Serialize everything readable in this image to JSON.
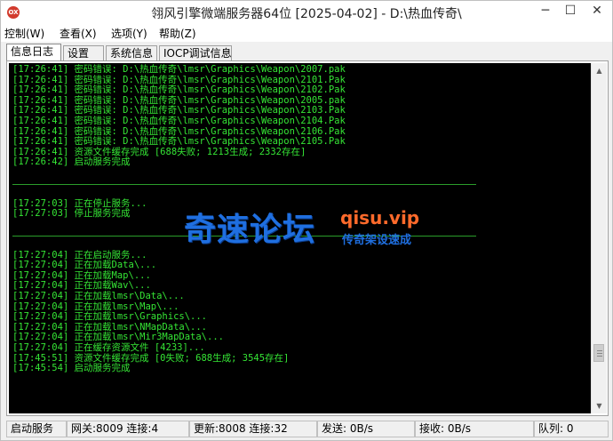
{
  "window": {
    "title": "翎风引擎微端服务器64位 [2025-04-02] - D:\\热血传奇\\",
    "icon_label": "OX",
    "minimize_glyph": "─",
    "maximize_glyph": "☐",
    "close_glyph": "✕"
  },
  "menu": [
    {
      "label": "控制(W)"
    },
    {
      "label": "查看(X)"
    },
    {
      "label": "选项(Y)"
    },
    {
      "label": "帮助(Z)"
    }
  ],
  "tabs": [
    {
      "label": "信息日志",
      "active": true
    },
    {
      "label": "设置",
      "active": false
    },
    {
      "label": "系统信息",
      "active": false
    },
    {
      "label": "IOCP调试信息",
      "active": false
    }
  ],
  "log_lines": [
    "[17:26:41] 密码错误: D:\\热血传奇\\lmsr\\Graphics\\Weapon\\2007.pak",
    "[17:26:41] 密码错误: D:\\热血传奇\\lmsr\\Graphics\\Weapon\\2101.Pak",
    "[17:26:41] 密码错误: D:\\热血传奇\\lmsr\\Graphics\\Weapon\\2102.Pak",
    "[17:26:41] 密码错误: D:\\热血传奇\\lmsr\\Graphics\\Weapon\\2005.pak",
    "[17:26:41] 密码错误: D:\\热血传奇\\lmsr\\Graphics\\Weapon\\2103.Pak",
    "[17:26:41] 密码错误: D:\\热血传奇\\lmsr\\Graphics\\Weapon\\2104.Pak",
    "[17:26:41] 密码错误: D:\\热血传奇\\lmsr\\Graphics\\Weapon\\2106.Pak",
    "[17:26:41] 密码错误: D:\\热血传奇\\lmsr\\Graphics\\Weapon\\2105.Pak",
    "[17:26:41] 资源文件缓存完成 [688失败; 1213生成; 2332存在]",
    "[17:26:42] 启动服务完成",
    "",
    "---",
    "",
    "[17:27:03] 正在停止服务...",
    "[17:27:03] 停止服务完成",
    "",
    "---",
    "",
    "[17:27:04] 正在启动服务...",
    "[17:27:04] 正在加载Data\\...",
    "[17:27:04] 正在加载Map\\...",
    "[17:27:04] 正在加载Wav\\...",
    "[17:27:04] 正在加载lmsr\\Data\\...",
    "[17:27:04] 正在加载lmsr\\Map\\...",
    "[17:27:04] 正在加载lmsr\\Graphics\\...",
    "[17:27:04] 正在加载lmsr\\NMapData\\...",
    "[17:27:04] 正在加载lmsr\\Mir3MapData\\...",
    "[17:27:04] 正在缓存资源文件 [4233]...",
    "[17:45:51] 资源文件缓存完成 [0失败; 688生成; 3545存在]",
    "[17:45:54] 启动服务完成"
  ],
  "watermark": {
    "brand_cn": "奇速论坛",
    "brand_en": "qisu.vip",
    "slogan": "传奇架设速成"
  },
  "status": [
    {
      "label": "启动服务"
    },
    {
      "label": "网关:8009  连接:4"
    },
    {
      "label": "更新:8008  连接:32"
    },
    {
      "label": "发送: 0B/s"
    },
    {
      "label": "接收: 0B/s"
    },
    {
      "label": "队列: 0"
    }
  ],
  "scroll": {
    "position": 0.88
  },
  "colors": {
    "log_text": "#35e535",
    "console_bg": "#000000",
    "watermark_blue": "#1f6fe0",
    "watermark_orange": "#ff6a2b"
  }
}
